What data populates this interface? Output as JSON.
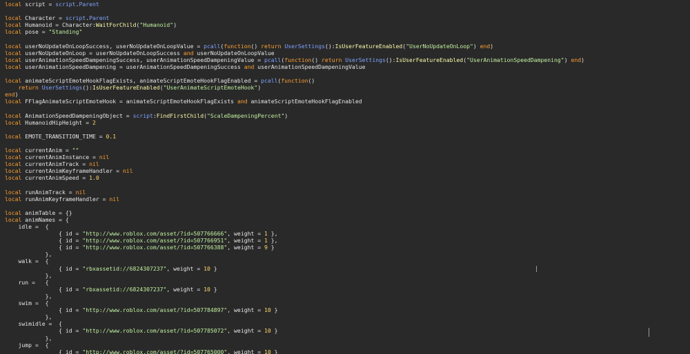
{
  "colors": {
    "background": "#292929",
    "text": "#e6e6e6",
    "keyword": "#fda033",
    "string": "#c1f0a0",
    "number": "#ffd66b",
    "builtin": "#7fa3ff",
    "method": "#fdfbab"
  },
  "editor": {
    "lines": [
      [
        [
          "kw",
          "local"
        ],
        [
          "id",
          " script = "
        ],
        [
          "blt",
          "script"
        ],
        [
          "id",
          "."
        ],
        [
          "blt",
          "Parent"
        ]
      ],
      [],
      [
        [
          "kw",
          "local"
        ],
        [
          "id",
          " Character = "
        ],
        [
          "blt",
          "script"
        ],
        [
          "id",
          "."
        ],
        [
          "blt",
          "Parent"
        ]
      ],
      [
        [
          "kw",
          "local"
        ],
        [
          "id",
          " Humanoid = Character:"
        ],
        [
          "mth",
          "WaitForChild"
        ],
        [
          "id",
          "("
        ],
        [
          "str",
          "\"Humanoid\""
        ],
        [
          "id",
          ")"
        ]
      ],
      [
        [
          "kw",
          "local"
        ],
        [
          "id",
          " pose = "
        ],
        [
          "str",
          "\"Standing\""
        ]
      ],
      [],
      [
        [
          "kw",
          "local"
        ],
        [
          "id",
          " userNoUpdateOnLoopSuccess, userNoUpdateOnLoopValue = "
        ],
        [
          "blt",
          "pcall"
        ],
        [
          "id",
          "("
        ],
        [
          "kw",
          "function"
        ],
        [
          "id",
          "() "
        ],
        [
          "kw",
          "return"
        ],
        [
          "id",
          " "
        ],
        [
          "blt",
          "UserSettings"
        ],
        [
          "id",
          "():"
        ],
        [
          "mth",
          "IsUserFeatureEnabled"
        ],
        [
          "id",
          "("
        ],
        [
          "str",
          "\"UserNoUpdateOnLoop\""
        ],
        [
          "id",
          ") "
        ],
        [
          "kw",
          "end"
        ],
        [
          "id",
          ")"
        ]
      ],
      [
        [
          "kw",
          "local"
        ],
        [
          "id",
          " userNoUpdateOnLoop = userNoUpdateOnLoopSuccess "
        ],
        [
          "kw",
          "and"
        ],
        [
          "id",
          " userNoUpdateOnLoopValue"
        ]
      ],
      [
        [
          "kw",
          "local"
        ],
        [
          "id",
          " userAnimationSpeedDampeningSuccess, userAnimationSpeedDampeningValue = "
        ],
        [
          "blt",
          "pcall"
        ],
        [
          "id",
          "("
        ],
        [
          "kw",
          "function"
        ],
        [
          "id",
          "() "
        ],
        [
          "kw",
          "return"
        ],
        [
          "id",
          " "
        ],
        [
          "blt",
          "UserSettings"
        ],
        [
          "id",
          "():"
        ],
        [
          "mth",
          "IsUserFeatureEnabled"
        ],
        [
          "id",
          "("
        ],
        [
          "str",
          "\"UserAnimationSpeedDampening\""
        ],
        [
          "id",
          ") "
        ],
        [
          "kw",
          "end"
        ],
        [
          "id",
          ")"
        ]
      ],
      [
        [
          "kw",
          "local"
        ],
        [
          "id",
          " userAnimationSpeedDampening = userAnimationSpeedDampeningSuccess "
        ],
        [
          "kw",
          "and"
        ],
        [
          "id",
          " userAnimationSpeedDampeningValue"
        ]
      ],
      [],
      [
        [
          "kw",
          "local"
        ],
        [
          "id",
          " animateScriptEmoteHookFlagExists, animateScriptEmoteHookFlagEnabled = "
        ],
        [
          "blt",
          "pcall"
        ],
        [
          "id",
          "("
        ],
        [
          "kw",
          "function"
        ],
        [
          "id",
          "()"
        ]
      ],
      [
        [
          "id",
          "    "
        ],
        [
          "kw",
          "return"
        ],
        [
          "id",
          " "
        ],
        [
          "blt",
          "UserSettings"
        ],
        [
          "id",
          "():"
        ],
        [
          "mth",
          "IsUserFeatureEnabled"
        ],
        [
          "id",
          "("
        ],
        [
          "str",
          "\"UserAnimateScriptEmoteHook\""
        ],
        [
          "id",
          ")"
        ]
      ],
      [
        [
          "kw",
          "end"
        ],
        [
          "id",
          ")"
        ]
      ],
      [
        [
          "kw",
          "local"
        ],
        [
          "id",
          " FFlagAnimateScriptEmoteHook = animateScriptEmoteHookFlagExists "
        ],
        [
          "kw",
          "and"
        ],
        [
          "id",
          " animateScriptEmoteHookFlagEnabled"
        ]
      ],
      [],
      [
        [
          "kw",
          "local"
        ],
        [
          "id",
          " AnimationSpeedDampeningObject = "
        ],
        [
          "blt",
          "script"
        ],
        [
          "id",
          ":"
        ],
        [
          "mth",
          "FindFirstChild"
        ],
        [
          "id",
          "("
        ],
        [
          "str",
          "\"ScaleDampeningPercent\""
        ],
        [
          "id",
          ")"
        ]
      ],
      [
        [
          "kw",
          "local"
        ],
        [
          "id",
          " HumanoidHipHeight = "
        ],
        [
          "num",
          "2"
        ]
      ],
      [],
      [
        [
          "kw",
          "local"
        ],
        [
          "id",
          " EMOTE_TRANSITION_TIME = "
        ],
        [
          "num",
          "0.1"
        ]
      ],
      [],
      [
        [
          "kw",
          "local"
        ],
        [
          "id",
          " currentAnim = "
        ],
        [
          "str",
          "\"\""
        ]
      ],
      [
        [
          "kw",
          "local"
        ],
        [
          "id",
          " currentAnimInstance = "
        ],
        [
          "kw",
          "nil"
        ]
      ],
      [
        [
          "kw",
          "local"
        ],
        [
          "id",
          " currentAnimTrack = "
        ],
        [
          "kw",
          "nil"
        ]
      ],
      [
        [
          "kw",
          "local"
        ],
        [
          "id",
          " currentAnimKeyframeHandler = "
        ],
        [
          "kw",
          "nil"
        ]
      ],
      [
        [
          "kw",
          "local"
        ],
        [
          "id",
          " currentAnimSpeed = "
        ],
        [
          "num",
          "1.0"
        ]
      ],
      [],
      [
        [
          "kw",
          "local"
        ],
        [
          "id",
          " runAnimTrack = "
        ],
        [
          "kw",
          "nil"
        ]
      ],
      [
        [
          "kw",
          "local"
        ],
        [
          "id",
          " runAnimKeyframeHandler = "
        ],
        [
          "kw",
          "nil"
        ]
      ],
      [],
      [
        [
          "kw",
          "local"
        ],
        [
          "id",
          " animTable = {}"
        ]
      ],
      [
        [
          "kw",
          "local"
        ],
        [
          "id",
          " animNames = {"
        ]
      ],
      [
        [
          "id",
          "    idle =  {"
        ]
      ],
      [
        [
          "id",
          "                { id = "
        ],
        [
          "str",
          "\"http://www.roblox.com/asset/?id=507766666\""
        ],
        [
          "id",
          ", weight = "
        ],
        [
          "num",
          "1"
        ],
        [
          "id",
          " },"
        ]
      ],
      [
        [
          "id",
          "                { id = "
        ],
        [
          "str",
          "\"http://www.roblox.com/asset/?id=507766951\""
        ],
        [
          "id",
          ", weight = "
        ],
        [
          "num",
          "1"
        ],
        [
          "id",
          " },"
        ]
      ],
      [
        [
          "id",
          "                { id = "
        ],
        [
          "str",
          "\"http://www.roblox.com/asset/?id=507766388\""
        ],
        [
          "id",
          ", weight = "
        ],
        [
          "num",
          "9"
        ],
        [
          "id",
          " }"
        ]
      ],
      [
        [
          "id",
          "            },"
        ]
      ],
      [
        [
          "id",
          "    walk =  {"
        ]
      ],
      [
        [
          "id",
          "                { id = "
        ],
        [
          "str",
          "\"rbxassetid://6824307237\""
        ],
        [
          "id",
          ", weight = "
        ],
        [
          "num",
          "10"
        ],
        [
          "id",
          " }"
        ]
      ],
      [
        [
          "id",
          "            },"
        ]
      ],
      [
        [
          "id",
          "    run =   {"
        ]
      ],
      [
        [
          "id",
          "                { id = "
        ],
        [
          "str",
          "\"rbxassetid://6824307237\""
        ],
        [
          "id",
          ", weight = "
        ],
        [
          "num",
          "10"
        ],
        [
          "id",
          " }"
        ]
      ],
      [
        [
          "id",
          "            },"
        ]
      ],
      [
        [
          "id",
          "    swim =  {"
        ]
      ],
      [
        [
          "id",
          "                { id = "
        ],
        [
          "str",
          "\"http://www.roblox.com/asset/?id=507784897\""
        ],
        [
          "id",
          ", weight = "
        ],
        [
          "num",
          "10"
        ],
        [
          "id",
          " }"
        ]
      ],
      [
        [
          "id",
          "            },"
        ]
      ],
      [
        [
          "id",
          "    swimidle =  {"
        ]
      ],
      [
        [
          "id",
          "                { id = "
        ],
        [
          "str",
          "\"http://www.roblox.com/asset/?id=507785072\""
        ],
        [
          "id",
          ", weight = "
        ],
        [
          "num",
          "10"
        ],
        [
          "id",
          " }"
        ]
      ],
      [
        [
          "id",
          "            },"
        ]
      ],
      [
        [
          "id",
          "    jump =  {"
        ]
      ],
      [
        [
          "id",
          "                { id = "
        ],
        [
          "str",
          "\"http://www.roblox.com/asset/?id=507765000\""
        ],
        [
          "id",
          ", weight = "
        ],
        [
          "num",
          "10"
        ],
        [
          "id",
          " }"
        ]
      ]
    ]
  }
}
